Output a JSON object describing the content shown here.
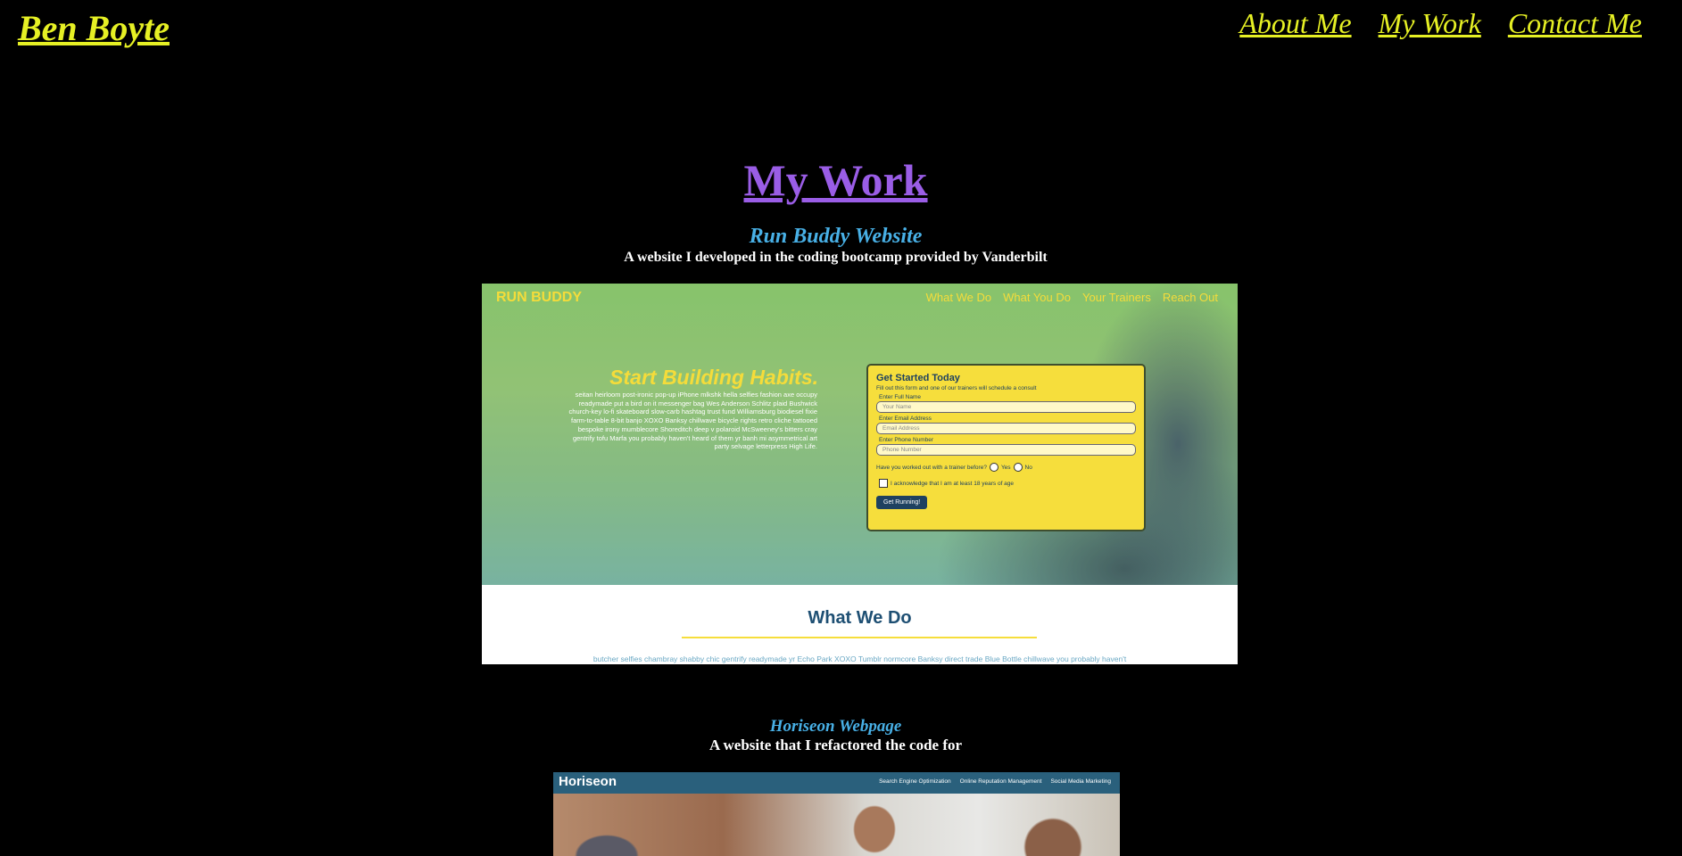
{
  "header": {
    "brand": "Ben Boyte",
    "nav": [
      "About Me",
      "My Work",
      "Contact Me"
    ]
  },
  "section": {
    "title": "My Work"
  },
  "projects": [
    {
      "title": "Run Buddy Website",
      "description": "A website I developed in the coding bootcamp provided by Vanderbilt",
      "preview": {
        "logo": "RUN BUDDY",
        "nav": [
          "What We Do",
          "What You Do",
          "Your Trainers",
          "Reach Out"
        ],
        "headline": "Start Building Habits.",
        "lorem": "seitan heirloom post-ironic pop-up iPhone mlkshk hella selfies fashion axe occupy readymade put a bird on it messenger bag Wes Anderson Schlitz plaid Bushwick church-key lo-fi skateboard slow-carb hashtag trust fund Williamsburg biodiesel fixie farm-to-table 8-bit banjo XOXO Banksy chillwave bicycle rights retro cliche tattooed bespoke irony mumblecore Shoreditch deep v polaroid McSweeney's bitters cray gentrify tofu Marfa you probably haven't heard of them yr banh mi asymmetrical art party selvage letterpress High Life.",
        "form": {
          "title": "Get Started Today",
          "subtitle": "Fill out this form and one of our trainers will schedule a consult",
          "name_label": "Enter Full Name",
          "name_placeholder": "Your Name",
          "email_label": "Enter Email Address",
          "email_placeholder": "Email Address",
          "phone_label": "Enter Phone Number",
          "phone_placeholder": "Phone Number",
          "question": "Have you worked out with a trainer before?",
          "yes": "Yes",
          "no": "No",
          "acknowledge": "I acknowledge that I am at least 18 years of age",
          "button": "Get Running!"
        },
        "section_title": "What We Do",
        "section_body": "butcher selfies chambray shabby chic gentrify readymade yr Echo Park XOXO Tumblr normcore Banksy direct trade Blue Bottle chillwave you probably haven't"
      }
    },
    {
      "title": "Horiseon Webpage",
      "description": "A website that I refactored the code for",
      "preview": {
        "logo": "Horiseon",
        "nav": [
          "Search Engine Optimization",
          "Online Reputation Management",
          "Social Media Marketing"
        ]
      }
    }
  ],
  "colors": {
    "background": "#000000",
    "header_link": "#e6f024",
    "section_title": "#9a5de6",
    "project_title": "#48b0e6",
    "description": "#ffffff"
  }
}
